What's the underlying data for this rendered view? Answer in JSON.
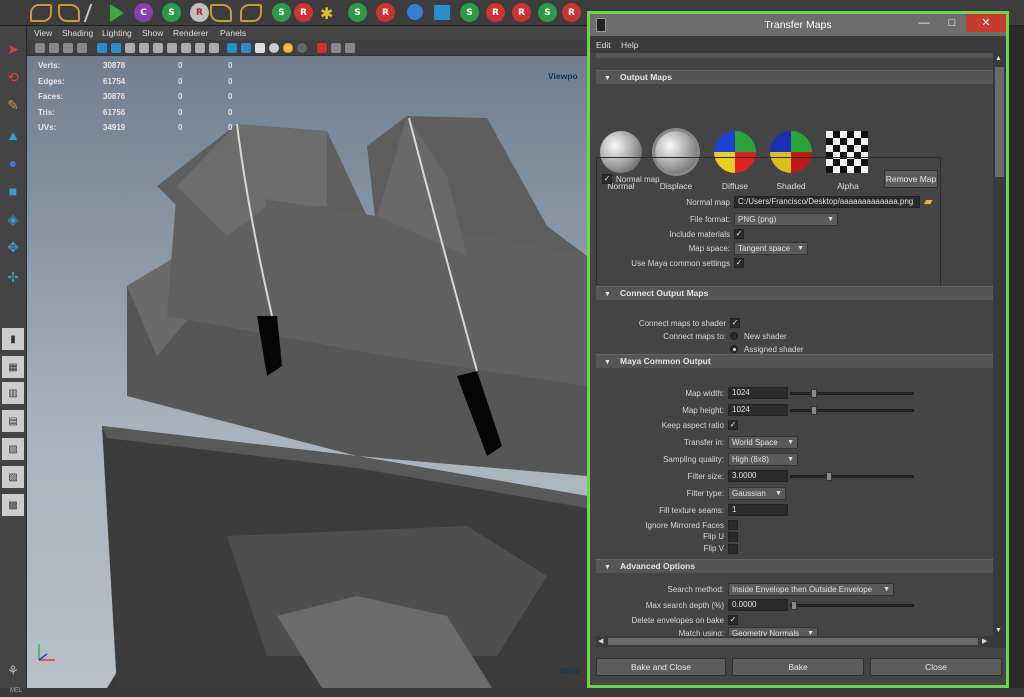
{
  "shelf": {
    "glyphs": [
      "S",
      "S",
      "R",
      "R",
      "S",
      "S",
      "R",
      "S",
      "R",
      "R"
    ]
  },
  "viewport": {
    "menu": [
      "View",
      "Shading",
      "Lighting",
      "Show",
      "Renderer",
      "Panels"
    ],
    "label": "Viewpo",
    "label2": "persp",
    "hud": [
      {
        "name": "Verts:",
        "v1": "30878",
        "v2": "0",
        "v3": "0"
      },
      {
        "name": "Edges:",
        "v1": "61754",
        "v2": "0",
        "v3": "0"
      },
      {
        "name": "Faces:",
        "v1": "30876",
        "v2": "0",
        "v3": "0"
      },
      {
        "name": "Tris:",
        "v1": "61756",
        "v2": "0",
        "v3": "0"
      },
      {
        "name": "UVs:",
        "v1": "34919",
        "v2": "0",
        "v3": "0"
      }
    ]
  },
  "statusbar": {
    "text": "MEL"
  },
  "dialog": {
    "title": "Transfer Maps",
    "window_controls": {
      "minimize": "—",
      "maximize": "□",
      "close": "✕"
    },
    "menu": [
      "Edit",
      "Help"
    ],
    "sections": {
      "output_maps": "Output Maps",
      "connect": "Connect Output Maps",
      "common": "Maya Common Output",
      "advanced": "Advanced Options"
    },
    "map_types": [
      {
        "label": "Normal"
      },
      {
        "label": "Displace"
      },
      {
        "label": "Diffuse"
      },
      {
        "label": "Shaded"
      },
      {
        "label": "Alpha"
      }
    ],
    "normal_map": {
      "checkbox_label": "Normal map",
      "remove_button": "Remove Map",
      "path_label": "Normal map",
      "path_value": "C:/Users/Francisco/Desktop/aaaaaaaaaaaaa.png",
      "format_label": "File format:",
      "format_value": "PNG (png)",
      "include_label": "Include materials",
      "space_label": "Map space:",
      "space_value": "Tangent space",
      "common_label": "Use Maya common settings"
    },
    "connect": {
      "shader_label": "Connect maps to shader",
      "to_label": "Connect maps to:",
      "opt_new": "New shader",
      "opt_assigned": "Assigned shader"
    },
    "common": {
      "width_label": "Map width:",
      "width_value": "1024",
      "width_fraction": 0.17,
      "height_label": "Map height:",
      "height_value": "1024",
      "height_fraction": 0.17,
      "aspect_label": "Keep aspect ratio",
      "transfer_label": "Transfer in:",
      "transfer_value": "World Space",
      "sampling_label": "Sampling quality:",
      "sampling_value": "High (8x8)",
      "filter_size_label": "Filter size:",
      "filter_size_value": "3.0000",
      "filter_size_fraction": 0.3,
      "filter_type_label": "Filter type:",
      "filter_type_value": "Gaussian",
      "fill_label": "Fill texture seams:",
      "fill_value": "1",
      "mirror_label": "Ignore Mirrored Faces",
      "flipu_label": "Flip U",
      "flipv_label": "Flip V"
    },
    "advanced": {
      "search_label": "Search method:",
      "search_value": "Inside Envelope then Outside Envelope",
      "depth_label": "Max search depth (%)",
      "depth_value": "0.0000",
      "depth_fraction": 0.0,
      "delete_label": "Delete envelopes on bake",
      "match_label": "Match using:",
      "match_value": "Geometry Normals"
    },
    "buttons": {
      "bake_close": "Bake and Close",
      "bake": "Bake",
      "close": "Close"
    }
  }
}
